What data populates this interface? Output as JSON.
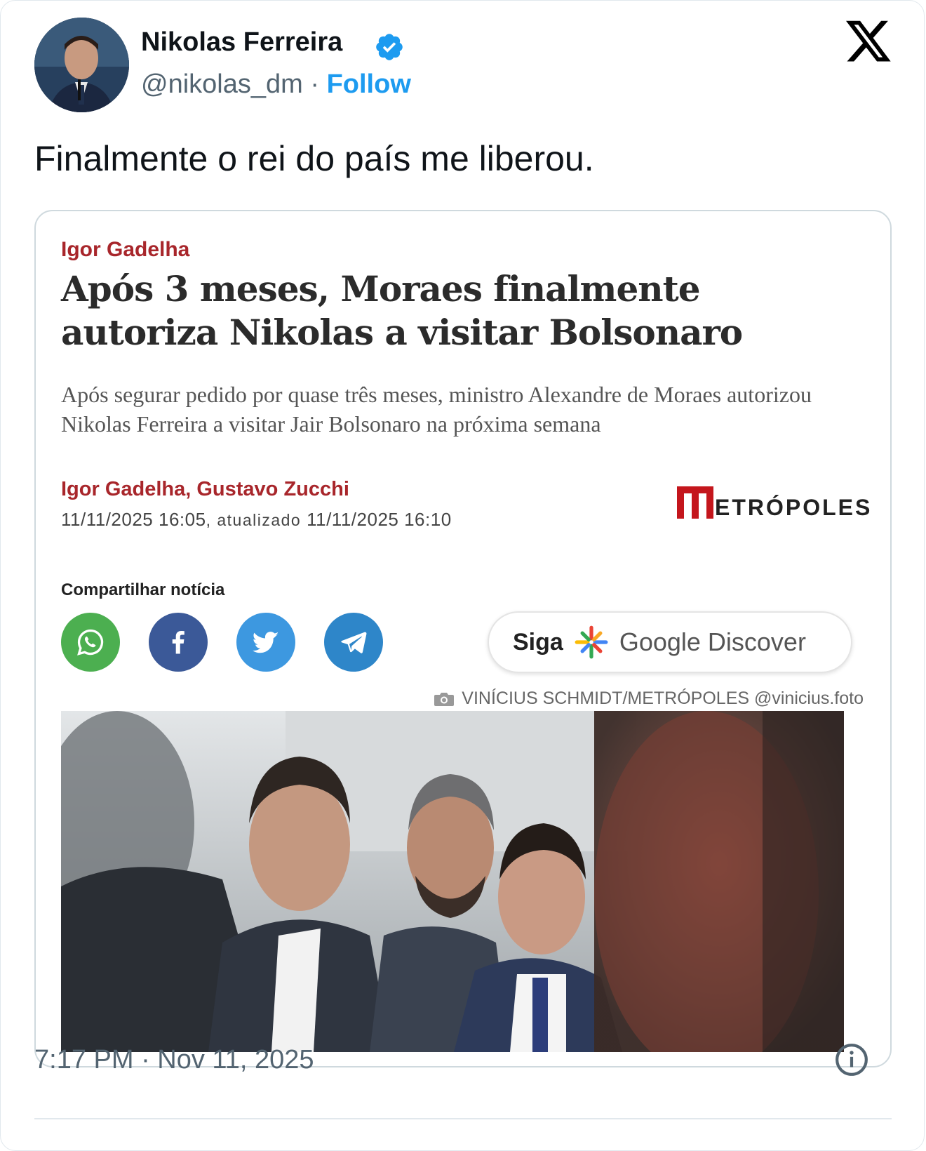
{
  "tweet": {
    "author_name": "Nikolas Ferreira",
    "handle": "@nikolas_dm",
    "separator": " · ",
    "follow_label": "Follow",
    "text": "Finalmente o rei do país me liberou.",
    "timestamp": "7:17 PM · Nov 11, 2025",
    "colors": {
      "accent": "#1d9bf0",
      "text": "#0f1419",
      "muted": "#536471"
    }
  },
  "article": {
    "kicker": "Igor Gadelha",
    "headline": "Após 3 meses, Moraes finalmente autoriza Nikolas a visitar Bolsonaro",
    "subhead": "Após segurar pedido por quase três meses, ministro Alexandre de Moraes autorizou Nikolas Ferreira a visitar Jair Bolsonaro na próxima semana",
    "authors": "Igor Gadelha, Gustavo Zucchi",
    "date_published": "11/11/2025 16:05",
    "updated_label": ", atualizado ",
    "date_updated": "11/11/2025 16:10",
    "logo_text": "ETRÓPOLES",
    "share_label": "Compartilhar notícia",
    "share_buttons": [
      {
        "name": "whatsapp",
        "color": "#4caf50"
      },
      {
        "name": "facebook",
        "color": "#3b5998"
      },
      {
        "name": "twitter",
        "color": "#3d98e0"
      },
      {
        "name": "telegram",
        "color": "#2e86c9"
      }
    ],
    "siga_label": "Siga",
    "google_discover_label": "Google Discover",
    "photo_credit": "VINÍCIUS SCHMIDT/METRÓPOLES @vinicius.foto",
    "colors": {
      "brand_red": "#a8262b"
    }
  }
}
